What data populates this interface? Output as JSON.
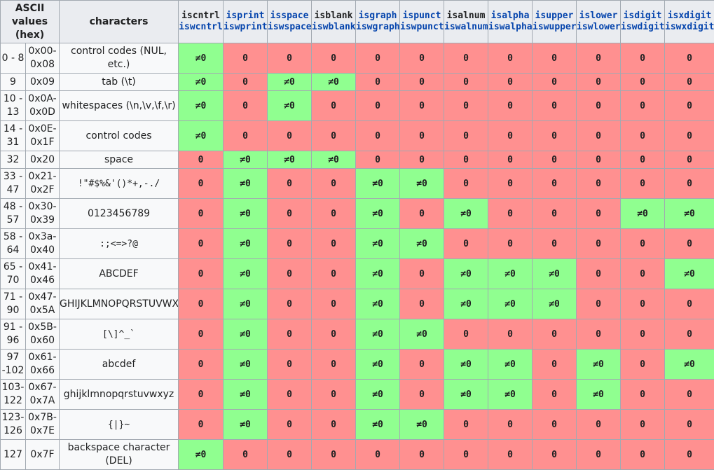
{
  "header": {
    "ascii": "ASCII values (hex)",
    "characters": "characters",
    "functions": [
      {
        "name": "iscntrl",
        "wname": "iswcntrl",
        "link": false
      },
      {
        "name": "isprint",
        "wname": "iswprint",
        "link": true
      },
      {
        "name": "isspace",
        "wname": "iswspace",
        "link": true
      },
      {
        "name": "isblank",
        "wname": "iswblank",
        "link": false
      },
      {
        "name": "isgraph",
        "wname": "iswgraph",
        "link": true
      },
      {
        "name": "ispunct",
        "wname": "iswpunct",
        "link": true
      },
      {
        "name": "isalnum",
        "wname": "iswalnum",
        "link": false
      },
      {
        "name": "isalpha",
        "wname": "iswalpha",
        "link": true
      },
      {
        "name": "isupper",
        "wname": "iswupper",
        "link": true
      },
      {
        "name": "islower",
        "wname": "iswlower",
        "link": true
      },
      {
        "name": "isdigit",
        "wname": "iswdigit",
        "link": true
      },
      {
        "name": "isxdigit",
        "wname": "iswxdigit",
        "link": true
      }
    ]
  },
  "labels": {
    "true": "≠0",
    "false": "0"
  },
  "colors": {
    "true": "#90ff90",
    "false": "#ff9090",
    "header": "#eaecf0",
    "link": "#0645ad"
  },
  "rows": [
    {
      "dec": "0 - 8",
      "hex": "0x00-\n0x08",
      "chars": "control codes (NUL, etc.)",
      "mono": false,
      "vals": [
        1,
        0,
        0,
        0,
        0,
        0,
        0,
        0,
        0,
        0,
        0,
        0
      ]
    },
    {
      "dec": "9",
      "hex": "0x09",
      "chars": "tab (\\t)",
      "mono": false,
      "vals": [
        1,
        0,
        1,
        1,
        0,
        0,
        0,
        0,
        0,
        0,
        0,
        0
      ]
    },
    {
      "dec": "10 - 13",
      "hex": "0x0A-\n0x0D",
      "chars": "whitespaces (\\n,\\v,\\f,\\r)",
      "mono": false,
      "vals": [
        1,
        0,
        1,
        0,
        0,
        0,
        0,
        0,
        0,
        0,
        0,
        0
      ]
    },
    {
      "dec": "14 - 31",
      "hex": "0x0E-\n0x1F",
      "chars": "control codes",
      "mono": false,
      "vals": [
        1,
        0,
        0,
        0,
        0,
        0,
        0,
        0,
        0,
        0,
        0,
        0
      ]
    },
    {
      "dec": "32",
      "hex": "0x20",
      "chars": "space",
      "mono": false,
      "vals": [
        0,
        1,
        1,
        1,
        0,
        0,
        0,
        0,
        0,
        0,
        0,
        0
      ]
    },
    {
      "dec": "33 - 47",
      "hex": "0x21-\n0x2F",
      "chars": "!\"#$%&'()*+,-./",
      "mono": true,
      "vals": [
        0,
        1,
        0,
        0,
        1,
        1,
        0,
        0,
        0,
        0,
        0,
        0
      ]
    },
    {
      "dec": "48 - 57",
      "hex": "0x30-\n0x39",
      "chars": "0123456789",
      "mono": false,
      "vals": [
        0,
        1,
        0,
        0,
        1,
        0,
        1,
        0,
        0,
        0,
        1,
        1
      ]
    },
    {
      "dec": "58 - 64",
      "hex": "0x3a-\n0x40",
      "chars": ":;<=>?@",
      "mono": true,
      "vals": [
        0,
        1,
        0,
        0,
        1,
        1,
        0,
        0,
        0,
        0,
        0,
        0
      ]
    },
    {
      "dec": "65 - 70",
      "hex": "0x41-\n0x46",
      "chars": "ABCDEF",
      "mono": false,
      "vals": [
        0,
        1,
        0,
        0,
        1,
        0,
        1,
        1,
        1,
        0,
        0,
        1
      ]
    },
    {
      "dec": "71 - 90",
      "hex": "0x47-\n0x5A",
      "chars": "GHIJKLMNOPQRSTUVWXYZ",
      "mono": false,
      "vals": [
        0,
        1,
        0,
        0,
        1,
        0,
        1,
        1,
        1,
        0,
        0,
        0
      ]
    },
    {
      "dec": "91 - 96",
      "hex": "0x5B-\n0x60",
      "chars": "[\\]^_`",
      "mono": true,
      "vals": [
        0,
        1,
        0,
        0,
        1,
        1,
        0,
        0,
        0,
        0,
        0,
        0
      ]
    },
    {
      "dec": "97 -102",
      "hex": "0x61-\n0x66",
      "chars": "abcdef",
      "mono": false,
      "vals": [
        0,
        1,
        0,
        0,
        1,
        0,
        1,
        1,
        0,
        1,
        0,
        1
      ]
    },
    {
      "dec": "103-\n122",
      "hex": "0x67-\n0x7A",
      "chars": "ghijklmnopqrstuvwxyz",
      "mono": false,
      "vals": [
        0,
        1,
        0,
        0,
        1,
        0,
        1,
        1,
        0,
        1,
        0,
        0
      ]
    },
    {
      "dec": "123-\n126",
      "hex": "0x7B-\n0x7E",
      "chars": "{|}~",
      "mono": true,
      "vals": [
        0,
        1,
        0,
        0,
        1,
        1,
        0,
        0,
        0,
        0,
        0,
        0
      ]
    },
    {
      "dec": "127",
      "hex": "0x7F",
      "chars": "backspace character (DEL)",
      "mono": false,
      "vals": [
        1,
        0,
        0,
        0,
        0,
        0,
        0,
        0,
        0,
        0,
        0,
        0
      ]
    }
  ]
}
